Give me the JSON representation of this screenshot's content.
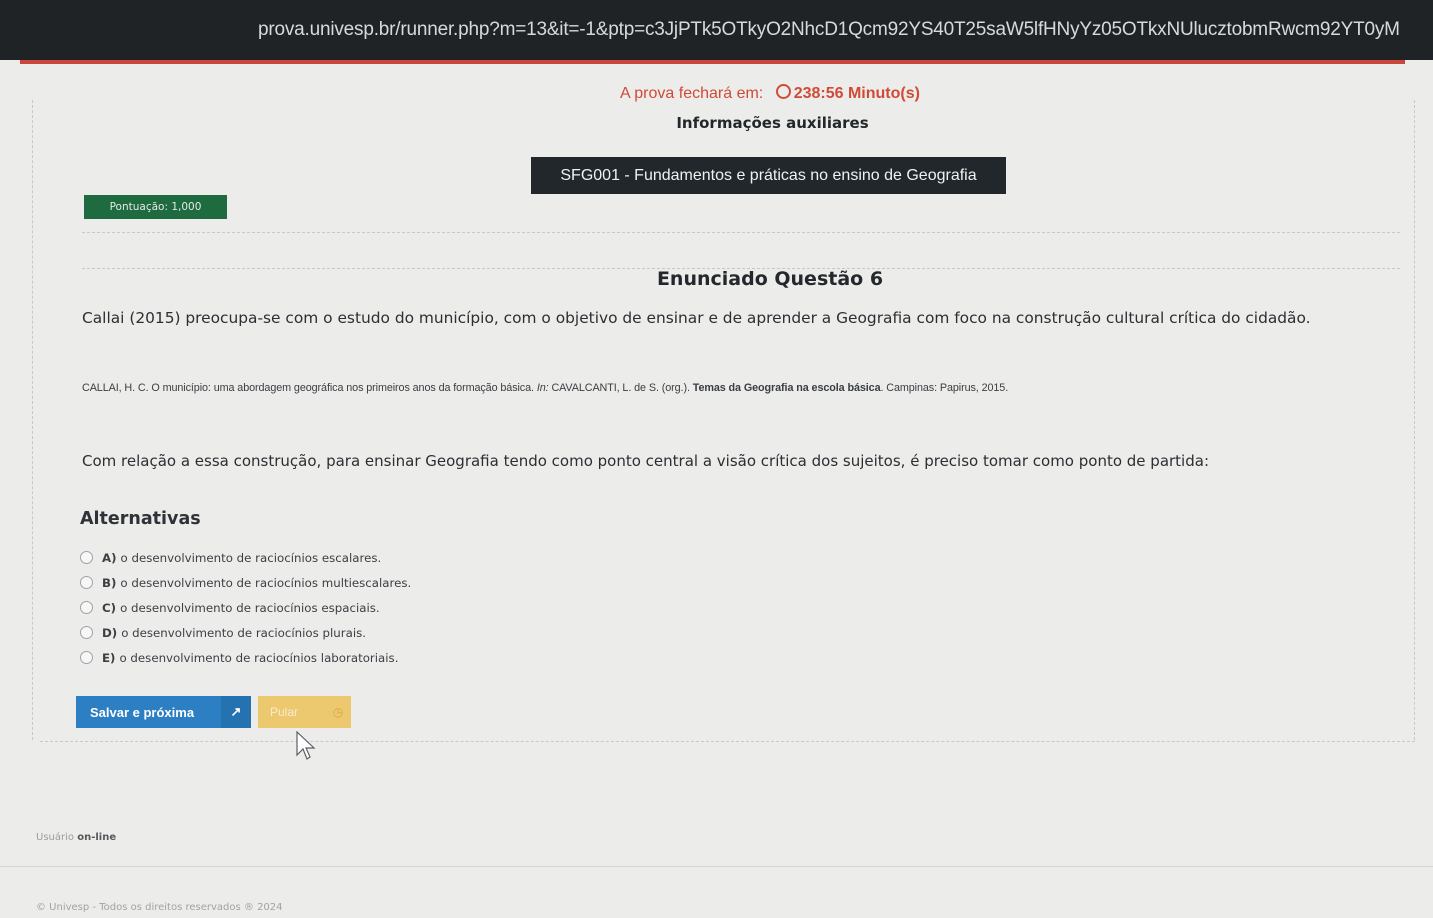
{
  "browser": {
    "url": "prova.univesp.br/runner.php?m=13&it=-1&ptp=c3JjPTk5OTkyO2NhcD1Qcm92YS40T25saW5lfHNyYz05OTkxNUlucztobmRwcm92YT0yM"
  },
  "header": {
    "timer_label": "A prova fechará em:",
    "timer_value": "238:56 Minuto(s)",
    "aux_info": "Informações auxiliares",
    "course": "SFG001 - Fundamentos e práticas no ensino de Geografia",
    "score": "Pontuação: 1,000"
  },
  "question": {
    "title": "Enunciado Questão 6",
    "stem": "Callai (2015) preocupa-se com o estudo do município, com o objetivo de ensinar e de aprender a Geografia com foco na construção cultural crítica do cidadão.",
    "reference_a": "CALLAI, H. C. O município: uma abordagem geográfica nos primeiros anos da formação básica.",
    "reference_in": "In:",
    "reference_b": "CAVALCANTI, L. de S. (org.).",
    "reference_bold": "Temas da Geografia na escola básica",
    "reference_c": ". Campinas: Papirus, 2015.",
    "prompt": "Com relação a essa construção, para ensinar Geografia tendo como ponto central a visão crítica dos sujeitos, é preciso tomar como ponto de partida:"
  },
  "alternatives": {
    "title": "Alternativas",
    "options": [
      {
        "letter": "A)",
        "text": "o desenvolvimento de raciocínios escalares."
      },
      {
        "letter": "B)",
        "text": "o desenvolvimento de raciocínios multiescalares."
      },
      {
        "letter": "C)",
        "text": "o desenvolvimento de raciocínios espaciais."
      },
      {
        "letter": "D)",
        "text": "o desenvolvimento de raciocínios plurais."
      },
      {
        "letter": "E)",
        "text": "o desenvolvimento de raciocínios laboratoriais."
      }
    ]
  },
  "actions": {
    "save_label": "Salvar e próxima",
    "save_icon": "arrow-icon",
    "skip_label": "Pular",
    "skip_icon": "clock-icon"
  },
  "status": {
    "user_label": "Usuário",
    "user_state": "on-line"
  },
  "footer": {
    "copyright": "© Univesp - Todos os direitos reservados ® 2024"
  },
  "colors": {
    "timer": "#d04a37",
    "course_bg": "#22272b",
    "score_bg": "#1d6b3f",
    "save_bg": "#2b7fc2",
    "skip_bg": "#ecc86e"
  }
}
